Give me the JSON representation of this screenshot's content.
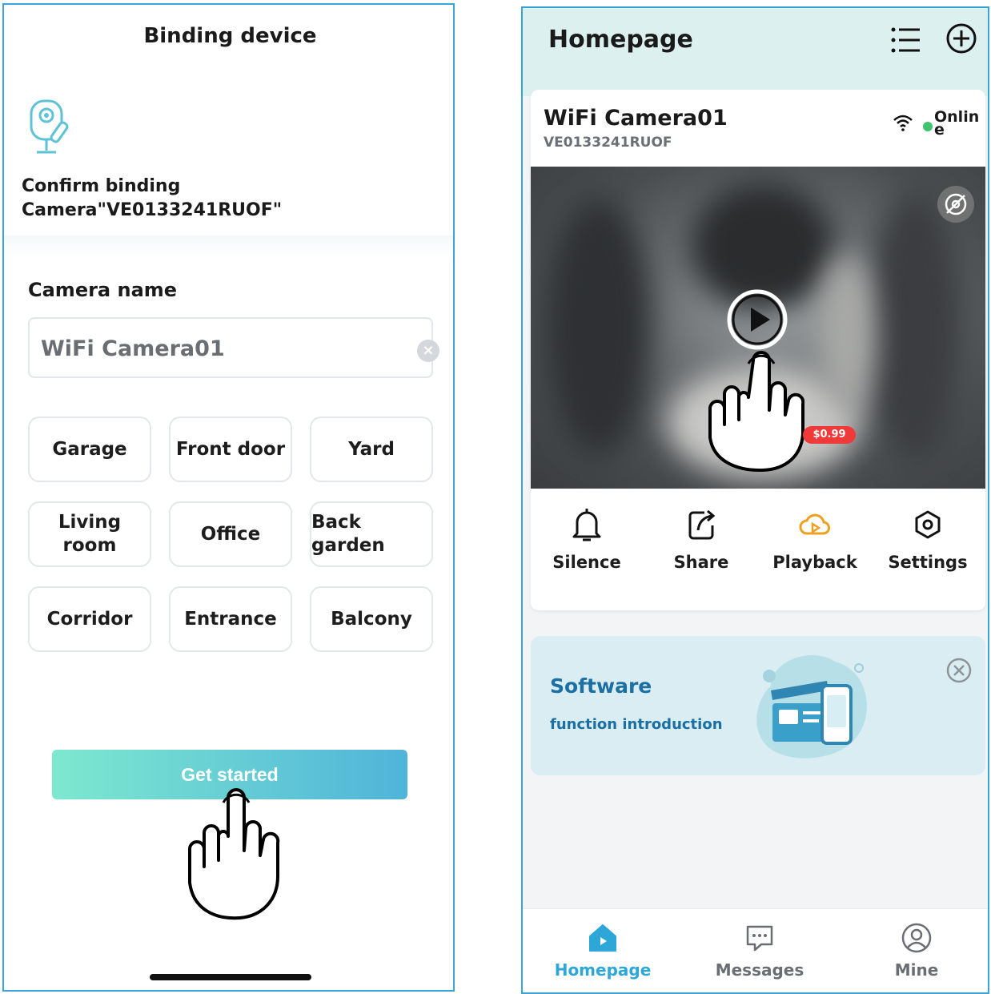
{
  "binding": {
    "title": "Binding device",
    "confirm_line1": "Confirm binding",
    "confirm_line2": "Camera\"VE0133241RUOF\"",
    "camera_name_label": "Camera name",
    "camera_name_value": "WiFi Camera01",
    "name_presets": [
      "Garage",
      "Front door",
      "Yard",
      "Living room",
      "Office",
      "Back garden",
      "Corridor",
      "Entrance",
      "Balcony"
    ],
    "start_button": "Get started"
  },
  "home": {
    "title": "Homepage",
    "camera_name": "WiFi Camera01",
    "camera_sn": "VE0133241RUOF",
    "status": "Online",
    "actions": {
      "silence": "Silence",
      "share": "Share",
      "playback": "Playback",
      "settings": "Settings",
      "playback_badge": "$0.99"
    },
    "promo": {
      "title": "Software",
      "subtitle": "function introduction"
    },
    "tabs": {
      "homepage": "Homepage",
      "messages": "Messages",
      "mine": "Mine"
    }
  },
  "colors": {
    "accent": "#2da6d8",
    "online": "#3ec46d",
    "badge": "#f03a3a",
    "header_bg": "#dcf1ef"
  }
}
